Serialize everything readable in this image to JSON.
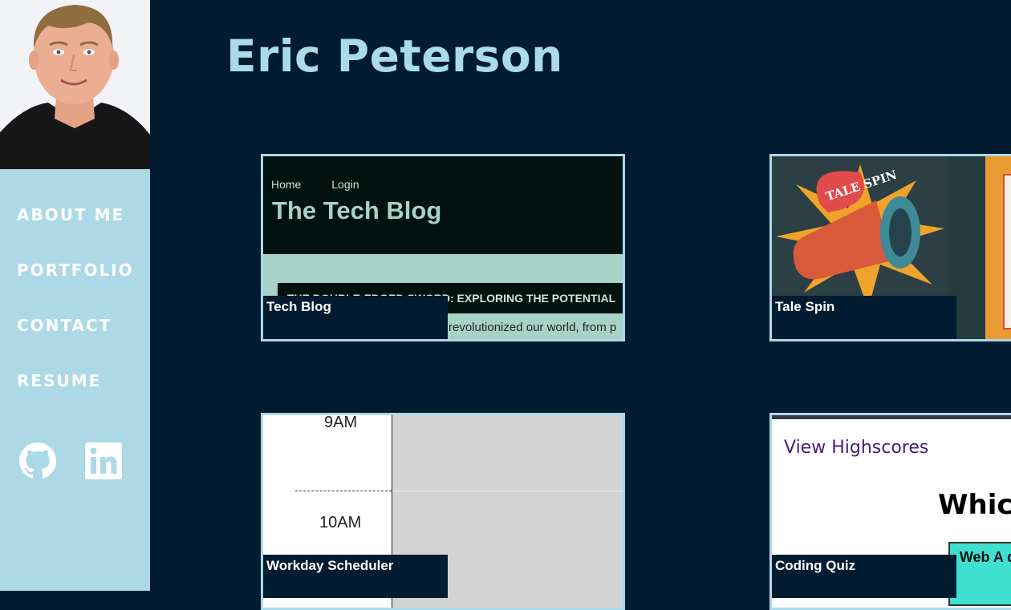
{
  "header": {
    "name": "Eric Peterson"
  },
  "nav": {
    "about": "ABOUT ME",
    "portfolio": "PORTFOLIO",
    "contact": "CONTACT",
    "resume": "RESUME"
  },
  "social": {
    "github_icon": "github-icon",
    "linkedin_icon": "linkedin-icon"
  },
  "colors": {
    "sidebar": "#add8e6",
    "background": "#011c30",
    "title": "#a9dbea"
  },
  "projects": [
    {
      "caption": "Tech Blog",
      "preview": {
        "nav_home": "Home",
        "nav_login": "Login",
        "title": "The Tech Blog",
        "post_title": "THE DOUBLE-EDGED SWORD: EXPLORING THE POTENTIAL",
        "post_text": "revolutionized our world, from p"
      }
    },
    {
      "caption": "Tale Spin"
    },
    {
      "caption": "Workday Scheduler",
      "preview": {
        "hour1": "9AM",
        "hour2": "10AM"
      }
    },
    {
      "caption": "Coding Quiz",
      "preview": {
        "link": "View Highscores",
        "question": "Whic",
        "answer": "Web A dire"
      }
    }
  ]
}
